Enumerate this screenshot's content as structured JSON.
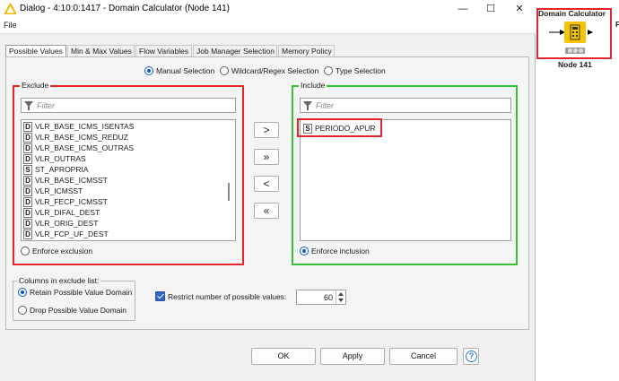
{
  "window": {
    "title": "Dialog - 4:10:0:1417 - Domain Calculator (Node 141)",
    "minimize": "—",
    "maximize": "☐",
    "close": "✕"
  },
  "menu": {
    "file": "File"
  },
  "tabs": [
    {
      "label": "Possible Values",
      "active": true
    },
    {
      "label": "Min & Max Values"
    },
    {
      "label": "Flow Variables"
    },
    {
      "label": "Job Manager Selection"
    },
    {
      "label": "Memory Policy"
    }
  ],
  "selection_mode": {
    "options": [
      "Manual Selection",
      "Wildcard/Regex Selection",
      "Type Selection"
    ],
    "selected": "Manual Selection"
  },
  "exclude": {
    "title": "Exclude",
    "filter_placeholder": "Filter",
    "items": [
      {
        "type": "D",
        "name": "VLR_BASE_ICMS_ISENTAS"
      },
      {
        "type": "D",
        "name": "VLR_BASE_ICMS_REDUZ"
      },
      {
        "type": "D",
        "name": "VLR_BASE_ICMS_OUTRAS"
      },
      {
        "type": "D",
        "name": "VLR_OUTRAS"
      },
      {
        "type": "S",
        "name": "ST_APROPRIA"
      },
      {
        "type": "D",
        "name": "VLR_BASE_ICMSST"
      },
      {
        "type": "D",
        "name": "VLR_ICMSST"
      },
      {
        "type": "D",
        "name": "VLR_FECP_ICMSST"
      },
      {
        "type": "D",
        "name": "VLR_DIFAL_DEST"
      },
      {
        "type": "D",
        "name": "VLR_ORIG_DEST"
      },
      {
        "type": "D",
        "name": "VLR_FCP_UF_DEST"
      }
    ],
    "enforce_label": "Enforce exclusion"
  },
  "include": {
    "title": "Include",
    "filter_placeholder": "Filter",
    "items": [
      {
        "type": "S",
        "name": "PERIODO_APUR"
      }
    ],
    "enforce_label": "Enforce inclusion"
  },
  "move_buttons": {
    "add": ">",
    "add_all": "»",
    "remove": "<",
    "remove_all": "«"
  },
  "columns_group": {
    "title": "Columns in exclude list:",
    "options": [
      "Retain Possible Value Domain",
      "Drop Possible Value Domain"
    ],
    "selected": "Retain Possible Value Domain"
  },
  "restrict": {
    "label": "Restrict number of possible values:",
    "checked": true,
    "value": "60"
  },
  "buttons": {
    "ok": "OK",
    "apply": "Apply",
    "cancel": "Cancel",
    "help": "?"
  },
  "node": {
    "title": "Domain Calculator",
    "label": "Node 141",
    "color": "#f5c400"
  }
}
